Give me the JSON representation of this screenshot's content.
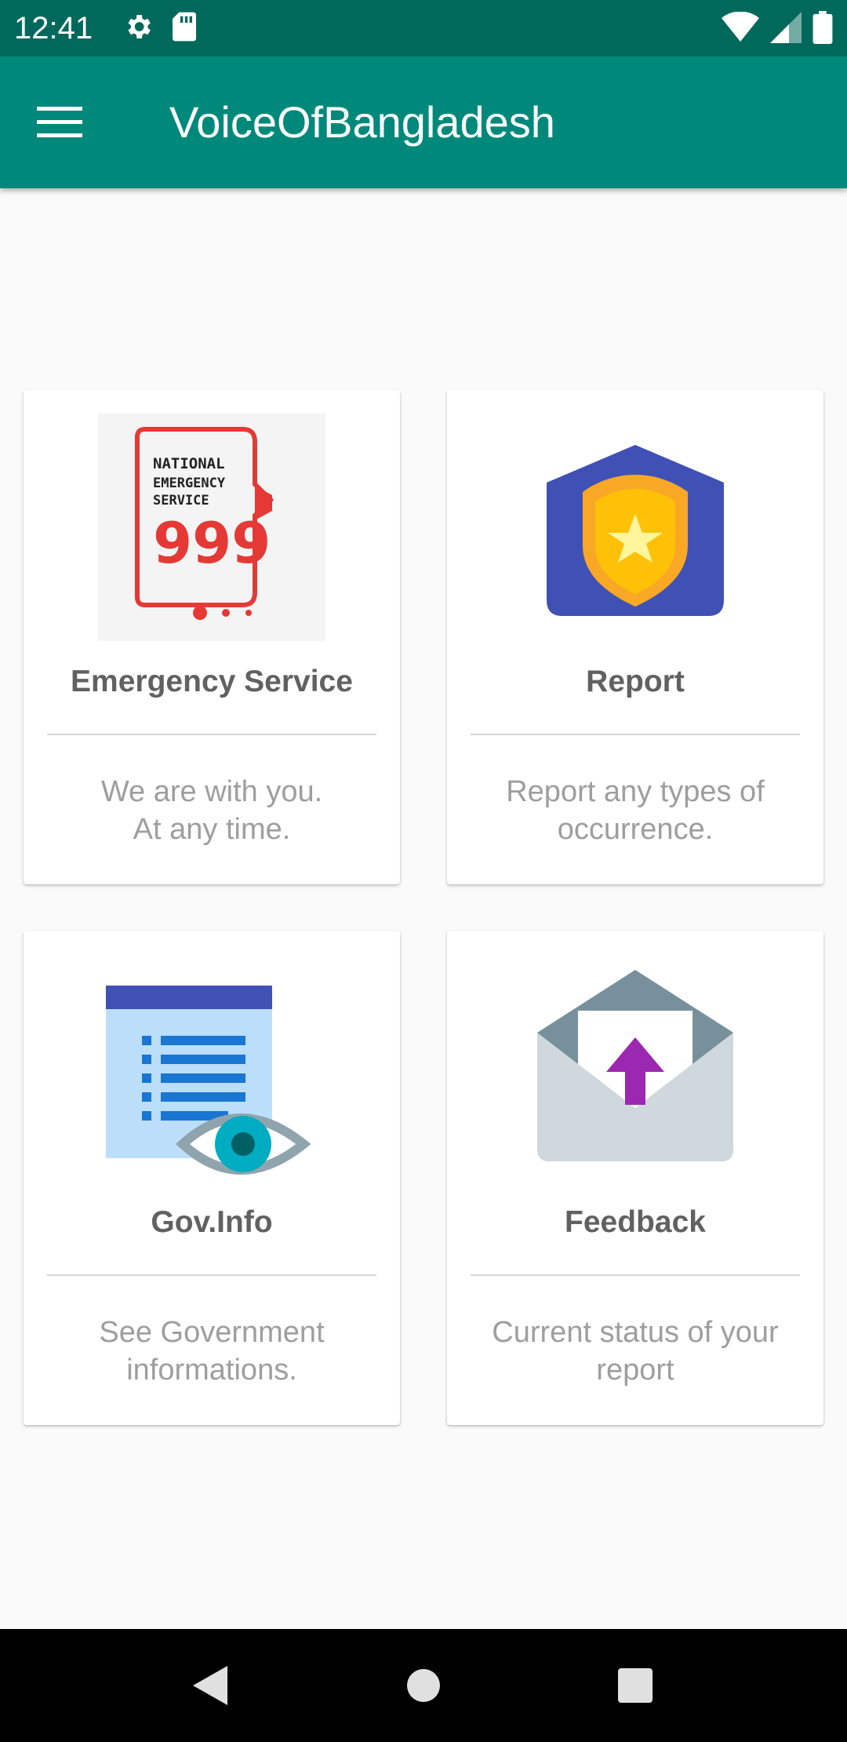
{
  "status_bar": {
    "time": "12:41",
    "left_icons": [
      "gear-icon",
      "sd-card-icon"
    ],
    "right_icons": [
      "wifi-icon",
      "cell-signal-icon",
      "battery-icon"
    ]
  },
  "app_bar": {
    "title": "VoiceOfBangladesh",
    "menu_icon": "hamburger-menu-icon",
    "background": "#00897b",
    "status_background": "#00695c"
  },
  "cards": [
    {
      "title": "Emergency Service",
      "description": "We are with you.\nAt any time.",
      "icon": "emergency-999-icon",
      "icon_text": [
        "NATIONAL",
        "EMERGENCY",
        "SERVICE",
        "999"
      ]
    },
    {
      "title": "Report",
      "description": "Report any types of occurrence.",
      "icon": "police-badge-icon"
    },
    {
      "title": "Gov.Info",
      "description": "See Government informations.",
      "icon": "document-eye-icon"
    },
    {
      "title": "Feedback",
      "description": "Current status of your report",
      "icon": "envelope-upload-icon"
    }
  ],
  "nav_bar": {
    "buttons": [
      "back-icon",
      "home-icon",
      "recents-icon"
    ]
  }
}
